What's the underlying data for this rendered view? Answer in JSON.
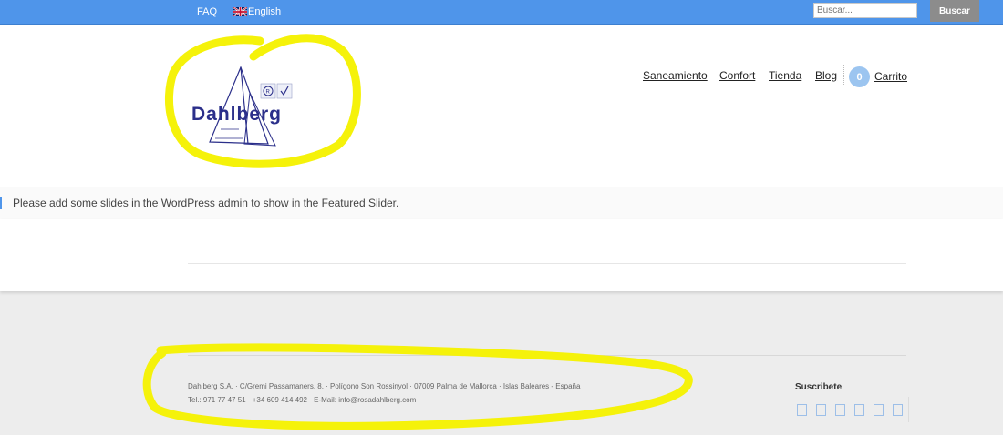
{
  "topbar": {
    "faq_label": "FAQ",
    "language_label": "English",
    "search_placeholder": "Buscar...",
    "search_button": "Buscar",
    "bar_color": "#4f95ea"
  },
  "header": {
    "logo_text": "Dahlberg",
    "nav": [
      "Saneamiento",
      "Confort",
      "Tienda",
      "Blog"
    ],
    "cart_count": "0",
    "cart_label": "Carrito"
  },
  "notice": {
    "text": "Please add some slides in the WordPress admin to show in the Featured Slider."
  },
  "footer": {
    "address": "Dahlberg S.A. · C/Gremi Passamaners, 8. · Polígono Son Rossinyol · 07009 Palma de Mallorca · Islas Baleares - España",
    "contact": "Tel.: 971 77 47 51 · +34 609 414 492 · E-Mail: info@rosadahlberg.com",
    "subscribe_title": "Suscribete",
    "social_icons": [
      "social-icon",
      "social-icon",
      "social-icon",
      "social-icon",
      "social-icon",
      "social-icon"
    ]
  },
  "annotation_color": "#f5f20a"
}
